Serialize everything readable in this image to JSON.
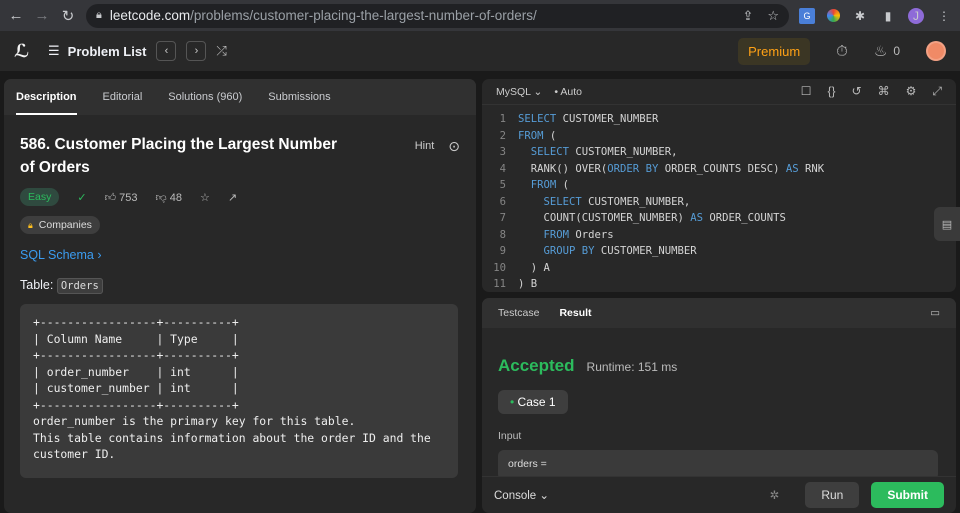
{
  "browser": {
    "url_host": "leetcode.com",
    "url_path": "/problems/customer-placing-the-largest-number-of-orders/",
    "profile_initial": "J"
  },
  "header": {
    "problem_list": "Problem List",
    "premium": "Premium",
    "streak": "0"
  },
  "left_tabs": [
    "Description",
    "Editorial",
    "Solutions (960)",
    "Submissions"
  ],
  "problem": {
    "title": "586. Customer Placing the Largest Number of Orders",
    "hint": "Hint",
    "difficulty": "Easy",
    "likes": "753",
    "dislikes": "48",
    "companies": "Companies",
    "schema_link": "SQL Schema",
    "table_prefix": "Table:",
    "table_name": "Orders",
    "schema_text": "+-----------------+----------+\n| Column Name     | Type     |\n+-----------------+----------+\n| order_number    | int      |\n| customer_number | int      |\n+-----------------+----------+\norder_number is the primary key for this table.\nThis table contains information about the order ID and the\ncustomer ID."
  },
  "editor": {
    "language": "MySQL",
    "mode": "Auto",
    "line_numbers": [
      "1",
      "2",
      "3",
      "4",
      "5",
      "6",
      "7",
      "8",
      "9",
      "10",
      "11"
    ]
  },
  "result": {
    "tabs": [
      "Testcase",
      "Result"
    ],
    "status": "Accepted",
    "runtime": "Runtime: 151 ms",
    "case": "Case 1",
    "input_label": "Input",
    "input_value": "orders ="
  },
  "bottom": {
    "console": "Console",
    "run": "Run",
    "submit": "Submit"
  }
}
